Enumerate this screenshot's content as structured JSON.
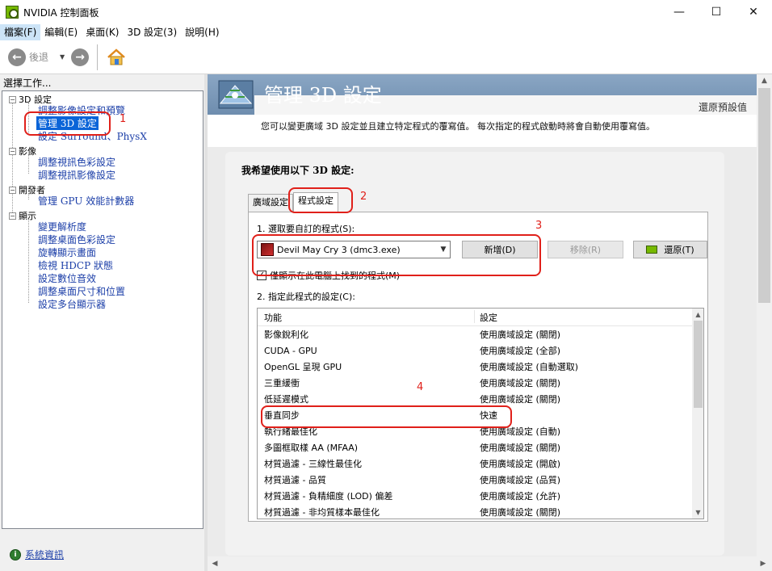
{
  "window": {
    "title": "NVIDIA 控制面板",
    "minimize_glyph": "—",
    "maximize_glyph": "☐",
    "close_glyph": "✕"
  },
  "menu": {
    "items": [
      "檔案(F)",
      "編輯(E)",
      "桌面(K)",
      "3D 設定(3)",
      "說明(H)"
    ]
  },
  "toolbar": {
    "back_label": "後退",
    "back_icon": "arrow-left-icon",
    "forward_icon": "arrow-right-icon",
    "home_icon": "home-icon"
  },
  "left_panel": {
    "header": "選擇工作...",
    "tree": [
      {
        "label": "3D 設定",
        "children": [
          "調整影像設定和預覽",
          "管理 3D 設定",
          "設定 Surround、PhysX"
        ]
      },
      {
        "label": "影像",
        "children": [
          "調整視訊色彩設定",
          "調整視訊影像設定"
        ]
      },
      {
        "label": "開發者",
        "children": [
          "管理 GPU 效能計數器"
        ]
      },
      {
        "label": "顯示",
        "children": [
          "變更解析度",
          "調整桌面色彩設定",
          "旋轉顯示畫面",
          "檢視 HDCP 狀態",
          "設定數位音效",
          "調整桌面尺寸和位置",
          "設定多台顯示器"
        ]
      }
    ],
    "selected_item": "管理 3D 設定",
    "system_info_link": "系統資訊"
  },
  "right_panel": {
    "page_title": "管理 3D 設定",
    "restore_defaults": "還原預設值",
    "description": "您可以變更廣域 3D 設定並且建立特定程式的覆寫值。 每次指定的程式啟動時將會自動使用覆寫值。",
    "settings_heading": "我希望使用以下 3D 設定:",
    "tabs": [
      "廣域設定",
      "程式設定"
    ],
    "active_tab": "程式設定",
    "step1_label": "1. 選取要自訂的程式(S):",
    "program_selected": "Devil May Cry 3 (dmc3.exe)",
    "add_button": "新增(D)",
    "remove_button": "移除(R)",
    "restore_button": "還原(T)",
    "checkbox_label": "僅顯示在此電腦上找到的程式(M)",
    "checkbox_checked": true,
    "step2_label": "2. 指定此程式的設定(C):",
    "grid": {
      "columns": [
        "功能",
        "設定"
      ],
      "rows": [
        {
          "feature": "影像銳利化",
          "setting": "使用廣域設定 (關閉)"
        },
        {
          "feature": "CUDA - GPU",
          "setting": "使用廣域設定 (全部)"
        },
        {
          "feature": "OpenGL 呈現 GPU",
          "setting": "使用廣域設定 (自動選取)"
        },
        {
          "feature": "三重緩衝",
          "setting": "使用廣域設定 (關閉)"
        },
        {
          "feature": "低延遲模式",
          "setting": "使用廣域設定 (關閉)"
        },
        {
          "feature": "垂直同步",
          "setting": "快速"
        },
        {
          "feature": "執行緒最佳化",
          "setting": "使用廣域設定 (自動)"
        },
        {
          "feature": "多圖框取樣 AA (MFAA)",
          "setting": "使用廣域設定 (關閉)"
        },
        {
          "feature": "材質過濾 - 三線性最佳化",
          "setting": "使用廣域設定 (開啟)"
        },
        {
          "feature": "材質過濾 - 品質",
          "setting": "使用廣域設定 (品質)"
        },
        {
          "feature": "材質過濾 - 負精細度 (LOD) 偏差",
          "setting": "使用廣域設定 (允許)"
        },
        {
          "feature": "材質過濾 - 非均質樣本最佳化",
          "setting": "使用廣域設定 (關閉)"
        }
      ]
    }
  },
  "annotations": {
    "color": "#e0201a",
    "labels": [
      "1",
      "2",
      "3",
      "4"
    ]
  }
}
